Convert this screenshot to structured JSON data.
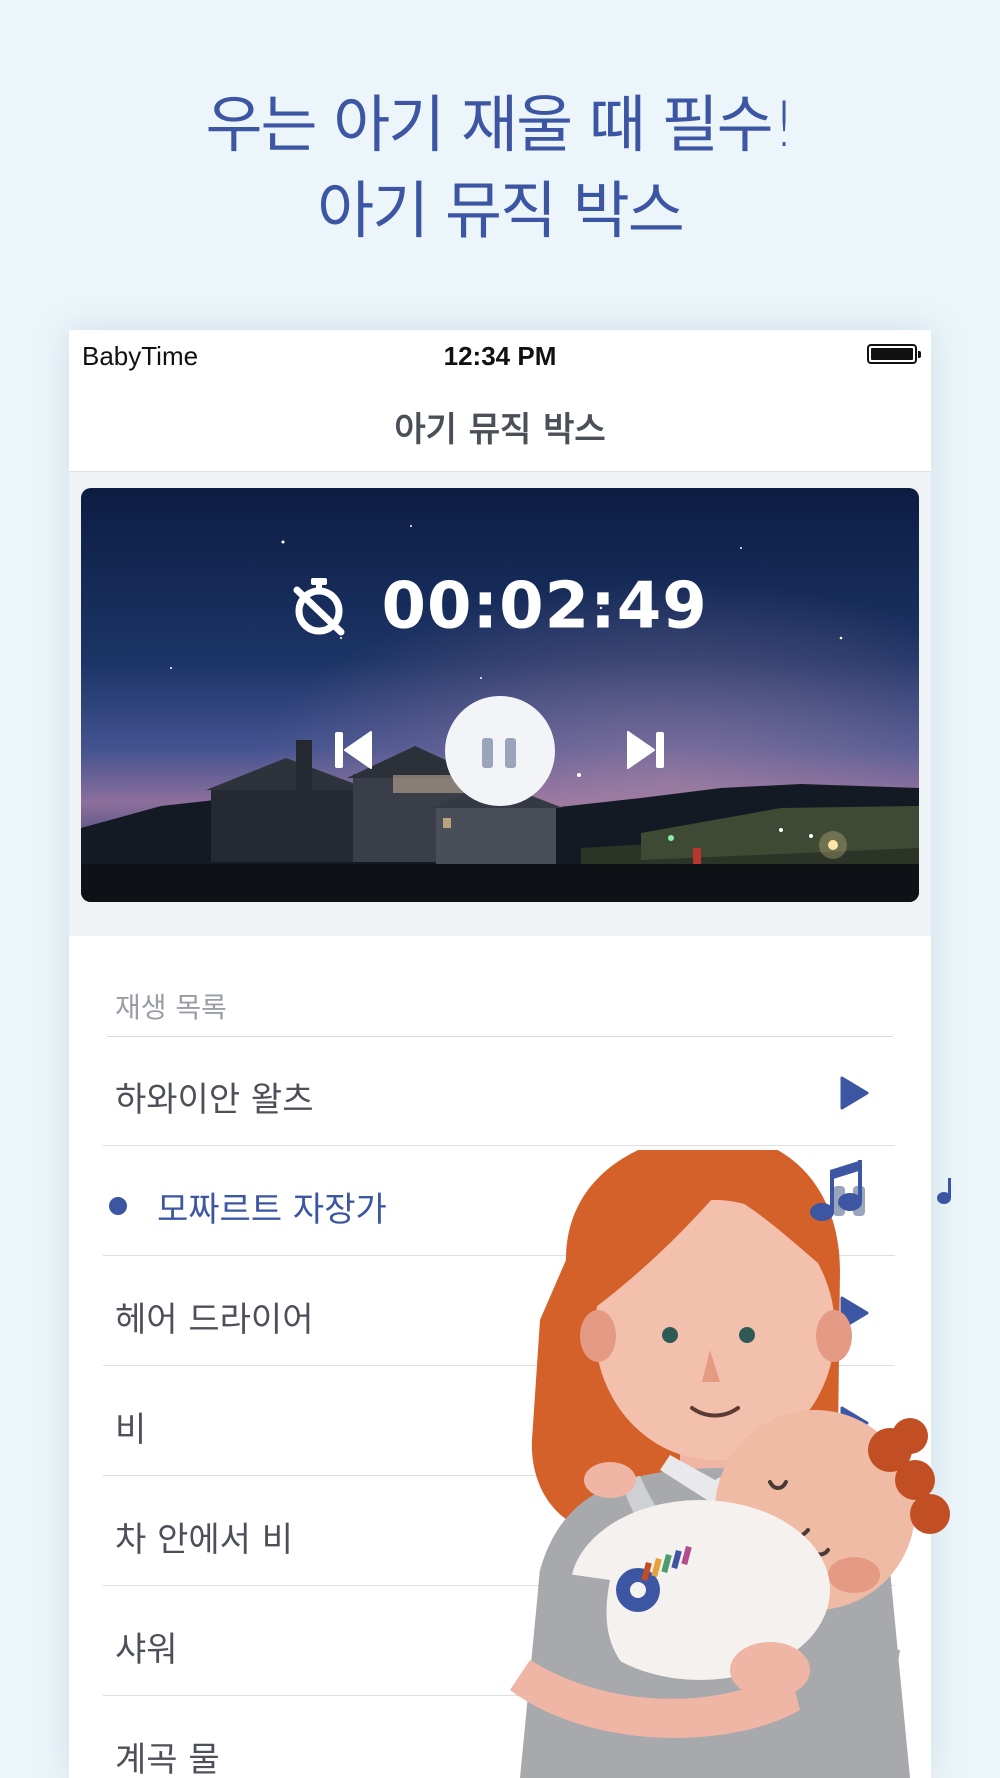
{
  "headline": {
    "line1": "우는 아기 재울 때 필수!",
    "line2": "아기 뮤직 박스"
  },
  "status_bar": {
    "carrier": "BabyTime",
    "time": "12:34 PM",
    "battery_level": 1.0
  },
  "nav": {
    "title": "아기 뮤직 박스"
  },
  "player": {
    "timer": "00:02:49",
    "state": "playing"
  },
  "playlist": {
    "header": "재생 목록",
    "items": [
      {
        "label": "하와이안 왈츠",
        "state": "play"
      },
      {
        "label": "모짜르트 자장가",
        "state": "pause",
        "active": true
      },
      {
        "label": "헤어 드라이어",
        "state": "play"
      },
      {
        "label": "비",
        "state": "play"
      },
      {
        "label": "차 안에서 비",
        "state": "play"
      },
      {
        "label": "샤워",
        "state": "play"
      },
      {
        "label": "계곡 물",
        "state": "play"
      }
    ]
  },
  "colors": {
    "accent": "#3d56a3",
    "background": "#ecf5f9",
    "muted": "#9aa4ba"
  }
}
